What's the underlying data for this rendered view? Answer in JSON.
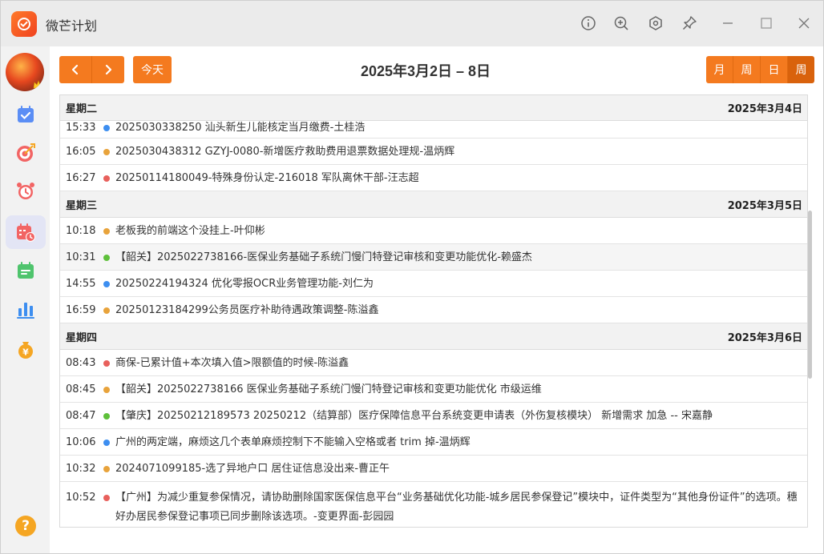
{
  "app": {
    "title": "微芒计划"
  },
  "toolbar": {
    "today_label": "今天",
    "range_title": "2025年3月2日 – 8日",
    "views": [
      "月",
      "周",
      "日",
      "周"
    ]
  },
  "colors": {
    "accent": "#f47a1f",
    "blue": "#3d8ef0",
    "orange": "#e8a33b",
    "red": "#e8605c",
    "green": "#5ec03a"
  },
  "days": [
    {
      "weekday": "星期二",
      "date": "2025年3月4日",
      "events": [
        {
          "time": "15:33",
          "color": "#3d8ef0",
          "title": "2025030338250 汕头新生儿能核定当月缴费-土桂浩"
        },
        {
          "time": "16:05",
          "color": "#e8a33b",
          "title": "2025030438312 GZYJ-0080-新增医疗救助费用退票数据处理规-温炳辉"
        },
        {
          "time": "16:27",
          "color": "#e8605c",
          "title": "20250114180049-特殊身份认定-216018 军队离休干部-汪志超"
        }
      ]
    },
    {
      "weekday": "星期三",
      "date": "2025年3月5日",
      "events": [
        {
          "time": "10:18",
          "color": "#e8a33b",
          "title": "老板我的前端这个没挂上-叶仰彬"
        },
        {
          "time": "10:31",
          "color": "#5ec03a",
          "title": "【韶关】2025022738166-医保业务基础子系统门慢门特登记审核和变更功能优化-赖盛杰"
        },
        {
          "time": "14:55",
          "color": "#3d8ef0",
          "title": "20250224194324 优化零报OCR业务管理功能-刘仁为"
        },
        {
          "time": "16:59",
          "color": "#e8a33b",
          "title": "20250123184299公务员医疗补助待遇政策调整-陈溢鑫"
        }
      ]
    },
    {
      "weekday": "星期四",
      "date": "2025年3月6日",
      "events": [
        {
          "time": "08:43",
          "color": "#e8605c",
          "title": "商保-已累计值+本次填入值>限额值的时候-陈溢鑫"
        },
        {
          "time": "08:45",
          "color": "#e8a33b",
          "title": "【韶关】2025022738166 医保业务基础子系统门慢门特登记审核和变更功能优化 市级运维"
        },
        {
          "time": "08:47",
          "color": "#5ec03a",
          "title": "【肇庆】20250212189573 20250212（结算部）医疗保障信息平台系统变更申请表（外伤复核模块） 新增需求 加急 -- 宋嘉静"
        },
        {
          "time": "10:06",
          "color": "#3d8ef0",
          "title": "广州的两定端，麻烦这几个表单麻烦控制下不能输入空格或者 trim 掉-温炳辉"
        },
        {
          "time": "10:32",
          "color": "#e8a33b",
          "title": "2024071099185-选了异地户口 居住证信息没出来-曹正午"
        },
        {
          "time": "10:52",
          "color": "#e8605c",
          "title": "【广州】为减少重复参保情况，请协助删除国家医保信息平台“业务基础优化功能-城乡居民参保登记”模块中，证件类型为“其他身份证件”的选项。穗好办居民参保登记事项已同步删除该选项。-变更界面-彭园园"
        }
      ]
    }
  ]
}
